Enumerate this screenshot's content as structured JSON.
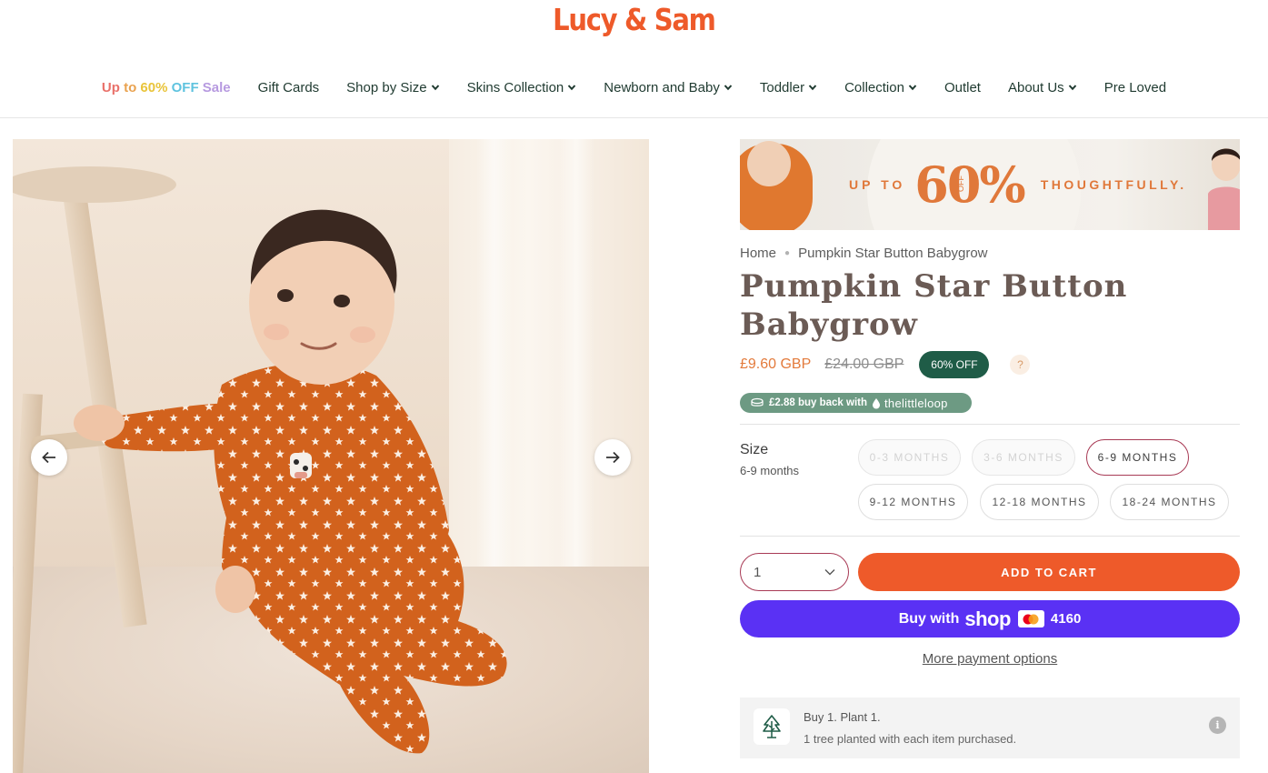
{
  "header": {
    "logo": "Lucy & Sam",
    "nav": [
      {
        "label": "Gift Cards",
        "dropdown": false
      },
      {
        "label": "Shop by Size",
        "dropdown": true
      },
      {
        "label": "Skins Collection",
        "dropdown": true
      },
      {
        "label": "Newborn and Baby",
        "dropdown": true
      },
      {
        "label": "Toddler",
        "dropdown": true
      },
      {
        "label": "Collection",
        "dropdown": true
      },
      {
        "label": "Outlet",
        "dropdown": false
      },
      {
        "label": "About Us",
        "dropdown": true
      },
      {
        "label": "Pre Loved",
        "dropdown": false
      }
    ],
    "sale": {
      "parts": [
        "Up",
        " to ",
        "60%",
        " OFF",
        " Sale"
      ],
      "colors": [
        "#e9716a",
        "#e9a24f",
        "#e9c43a",
        "#5fc3df",
        "#b79ae0"
      ]
    }
  },
  "banner": {
    "up_to": "UP TO",
    "percent": "60%",
    "off": "OFF",
    "tagline": "THOUGHTFULLY."
  },
  "breadcrumb": {
    "home": "Home",
    "current": "Pumpkin Star Button Babygrow"
  },
  "product": {
    "title": "Pumpkin Star Button Babygrow",
    "price": "£9.60 GBP",
    "compare_price": "£24.00 GBP",
    "discount_badge": "60% OFF",
    "help": "?",
    "buyback": "£2.88 buy back with",
    "buyback_brand": "thelittleloop"
  },
  "size": {
    "label": "Size",
    "selected_value": "6-9 months",
    "options": [
      {
        "label": "0-3 MONTHS",
        "state": "disabled"
      },
      {
        "label": "3-6 MONTHS",
        "state": "disabled"
      },
      {
        "label": "6-9 MONTHS",
        "state": "selected"
      },
      {
        "label": "9-12 MONTHS",
        "state": "available"
      },
      {
        "label": "12-18 MONTHS",
        "state": "available"
      },
      {
        "label": "18-24 MONTHS",
        "state": "available"
      }
    ]
  },
  "purchase": {
    "quantity": "1",
    "add_to_cart": "ADD TO CART",
    "shop_pay_prefix": "Buy with",
    "shop_pay_brand": "shop",
    "card_last4": "4160",
    "more_payment": "More payment options"
  },
  "plant": {
    "title": "Buy 1. Plant 1.",
    "subtitle": "1 tree planted with each item purchased.",
    "info": "i"
  },
  "colors": {
    "brand_orange": "#ee5a2a",
    "dark_green": "#1f5c47",
    "shop_pay_purple": "#5a31f4",
    "selected_border": "#a83a55",
    "loop_green": "#6d9a83"
  },
  "icons": [
    "chevron-down-icon",
    "arrow-left-icon",
    "arrow-right-icon",
    "tree-icon",
    "info-icon",
    "mastercard-icon",
    "loop-drop-icon"
  ]
}
